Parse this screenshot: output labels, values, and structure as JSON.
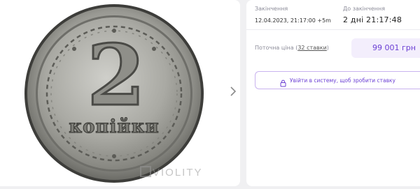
{
  "gallery": {
    "image_alt": "2 копійки coin",
    "coin_numeral": "2",
    "coin_word": "копійки",
    "watermark": "VIOLITY",
    "next_icon": "chevron-right-icon"
  },
  "auction": {
    "end_label": "Закінчення",
    "end_value": "12.04.2023, 21:17:00 +5m",
    "remaining_label": "До закінчення",
    "remaining_value": "2 дні 21:17:48",
    "price_label": "Поточна ціна",
    "bids_count": "32 ставки",
    "price_value": "99 001 грн",
    "login_button": "Увійти в систему, щоб зробити ставку",
    "login_icon": "lock-icon"
  },
  "colors": {
    "accent": "#6b3fd4",
    "price_bg": "#f3eefc",
    "button_border": "#c9b3ef"
  }
}
